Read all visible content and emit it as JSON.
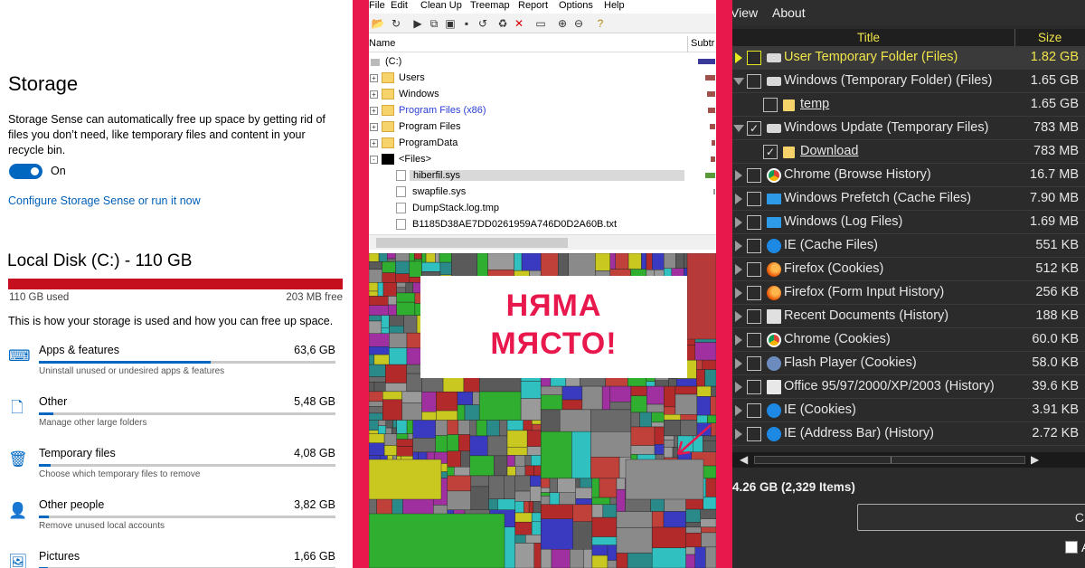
{
  "storage": {
    "title": "Storage",
    "description": "Storage Sense can automatically free up space by getting rid of files you don’t need, like temporary files and content in your recycle bin.",
    "toggle_label": "On",
    "toggle_on": true,
    "configure_link": "Configure Storage Sense or run it now",
    "disk_title": "Local Disk (C:) - 110 GB",
    "used_label": "110 GB used",
    "free_label": "203 MB free",
    "intro": "This is how your storage is used and how you can free up space.",
    "categories": [
      {
        "name": "Apps & features",
        "size": "63,6 GB",
        "hint": "Uninstall unused or undesired apps & features",
        "icon": "keyboard-icon",
        "fill": 0.58
      },
      {
        "name": "Other",
        "size": "5,48 GB",
        "hint": "Manage other large folders",
        "icon": "file-icon",
        "fill": 0.05
      },
      {
        "name": "Temporary files",
        "size": "4,08 GB",
        "hint": "Choose which temporary files to remove",
        "icon": "trash-icon",
        "fill": 0.04
      },
      {
        "name": "Other people",
        "size": "3,82 GB",
        "hint": "Remove unused local accounts",
        "icon": "user-icon",
        "fill": 0.035
      },
      {
        "name": "Pictures",
        "size": "1,66 GB",
        "hint": "",
        "icon": "picture-icon",
        "fill": 0.015
      }
    ],
    "accent_color": "#0067c0",
    "disk_bar_color": "#c50f1f"
  },
  "windirstat": {
    "menu": [
      "File",
      "Edit",
      "Clean Up",
      "Treemap",
      "Report",
      "Options",
      "Help"
    ],
    "columns": {
      "name": "Name",
      "subtree": "Subtr"
    },
    "tree": [
      {
        "label": "(C:)",
        "level": 0,
        "type": "drive",
        "expander": "",
        "bar": 0.95,
        "bar_color": "#3a3a9a"
      },
      {
        "label": "Users",
        "level": 1,
        "type": "folder",
        "expander": "+",
        "bar": 0.55,
        "bar_color": "#a0504a"
      },
      {
        "label": "Windows",
        "level": 1,
        "type": "folder",
        "expander": "+",
        "bar": 0.45,
        "bar_color": "#a0504a"
      },
      {
        "label": "Program Files (x86)",
        "level": 1,
        "type": "folder",
        "expander": "+",
        "bar": 0.4,
        "bar_color": "#a0504a",
        "highlight": true
      },
      {
        "label": "Program Files",
        "level": 1,
        "type": "folder",
        "expander": "+",
        "bar": 0.3,
        "bar_color": "#a0504a"
      },
      {
        "label": "ProgramData",
        "level": 1,
        "type": "folder",
        "expander": "+",
        "bar": 0.2,
        "bar_color": "#a0504a"
      },
      {
        "label": "<Files>",
        "level": 1,
        "type": "black",
        "expander": "-",
        "bar": 0.25,
        "bar_color": "#a0504a"
      },
      {
        "label": "hiberfil.sys",
        "level": 2,
        "type": "file",
        "expander": "",
        "bar": 0.55,
        "bar_color": "#5a9a3a",
        "selected": true
      },
      {
        "label": "swapfile.sys",
        "level": 2,
        "type": "file",
        "expander": "",
        "bar": 0.1,
        "bar_color": "#999999"
      },
      {
        "label": "DumpStack.log.tmp",
        "level": 2,
        "type": "file",
        "expander": "",
        "bar": 0,
        "bar_color": "#999999"
      },
      {
        "label": "B1185D38AE7DD0261959A746D0D2A60B.txt",
        "level": 2,
        "type": "file",
        "expander": "",
        "bar": 0,
        "bar_color": "#999999"
      }
    ],
    "overlay_line1": "НЯМА",
    "overlay_line2": "МЯСТО!",
    "overlay_color": "#e8174c"
  },
  "cleaner": {
    "menu": [
      "View",
      "About"
    ],
    "columns": {
      "title": "Title",
      "size": "Size"
    },
    "rows": [
      {
        "title": "User Temporary Folder (Files)",
        "size": "1.82 GB",
        "icon": "disk-icon",
        "checked": false,
        "expander": "yellow",
        "selected": true,
        "indent": 0
      },
      {
        "title": "Windows (Temporary Folder) (Files)",
        "size": "1.65 GB",
        "icon": "disk-icon",
        "checked": false,
        "expander": "open",
        "indent": 0
      },
      {
        "title": "temp",
        "size": "1.65 GB",
        "icon": "folder-icon",
        "checked": false,
        "expander": "none",
        "indent": 1,
        "underline": true
      },
      {
        "title": "Windows Update (Temporary Files)",
        "size": "783 MB",
        "icon": "disk-icon",
        "checked": true,
        "expander": "open",
        "indent": 0
      },
      {
        "title": "Download",
        "size": "783 MB",
        "icon": "folder-icon",
        "checked": true,
        "expander": "none",
        "indent": 1,
        "underline": true
      },
      {
        "title": "Chrome (Browse History)",
        "size": "16.7 MB",
        "icon": "chrome-icon",
        "checked": false,
        "expander": "closed",
        "indent": 0
      },
      {
        "title": "Windows Prefetch (Cache Files)",
        "size": "7.90 MB",
        "icon": "windows-icon",
        "checked": false,
        "expander": "closed",
        "indent": 0
      },
      {
        "title": "Windows (Log Files)",
        "size": "1.69 MB",
        "icon": "windows-icon",
        "checked": false,
        "expander": "closed",
        "indent": 0
      },
      {
        "title": "IE (Cache Files)",
        "size": "551 KB",
        "icon": "ie-icon",
        "checked": false,
        "expander": "closed",
        "indent": 0
      },
      {
        "title": "Firefox (Cookies)",
        "size": "512 KB",
        "icon": "firefox-icon",
        "checked": false,
        "expander": "closed",
        "indent": 0
      },
      {
        "title": "Firefox (Form Input History)",
        "size": "256 KB",
        "icon": "firefox-icon",
        "checked": false,
        "expander": "closed",
        "indent": 0
      },
      {
        "title": "Recent Documents (History)",
        "size": "188 KB",
        "icon": "document-icon",
        "checked": false,
        "expander": "closed",
        "indent": 0
      },
      {
        "title": "Chrome (Cookies)",
        "size": "60.0 KB",
        "icon": "chrome-icon",
        "checked": false,
        "expander": "closed",
        "indent": 0
      },
      {
        "title": "Flash Player (Cookies)",
        "size": "58.0 KB",
        "icon": "flash-icon",
        "checked": false,
        "expander": "closed",
        "indent": 0
      },
      {
        "title": "Office 95/97/2000/XP/2003 (History)",
        "size": "39.6 KB",
        "icon": "office-icon",
        "checked": false,
        "expander": "closed",
        "indent": 0
      },
      {
        "title": "IE (Cookies)",
        "size": "3.91 KB",
        "icon": "ie-icon",
        "checked": false,
        "expander": "closed",
        "indent": 0
      },
      {
        "title": "IE (Address Bar) (History)",
        "size": "2.72 KB",
        "icon": "ie-icon",
        "checked": false,
        "expander": "closed",
        "indent": 0
      }
    ],
    "summary": "4.26 GB (2,329  Items)",
    "button_label": "C",
    "checkbox_label": "A",
    "highlight_color": "#f0e54a"
  }
}
